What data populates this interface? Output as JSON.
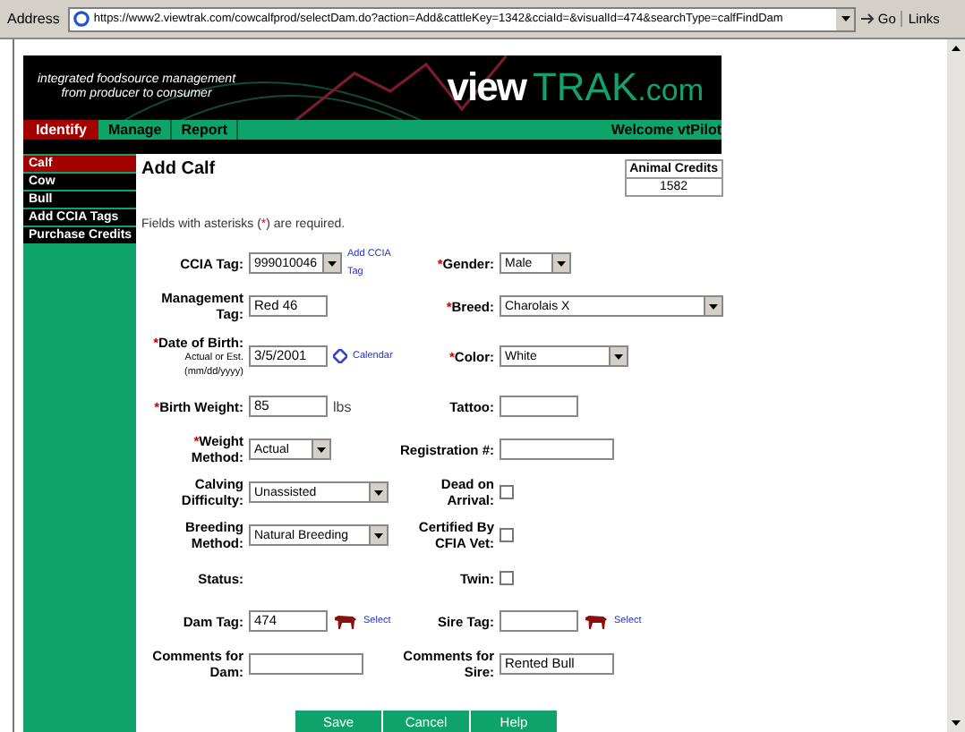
{
  "browser": {
    "address_label": "Address",
    "url": "https://www2.viewtrak.com/cowcalfprod/selectDam.do?action=Add&cattleKey=1342&cciaId=&visualId=474&searchType=calfFindDam",
    "go": "Go",
    "links": "Links"
  },
  "header": {
    "tagline_1": "integrated foodsource management",
    "tagline_2": "from producer to consumer",
    "logo_1": "view",
    "logo_2": "TRAK",
    "logo_3": ".com"
  },
  "nav": {
    "tabs": [
      {
        "label": "Identify",
        "selected": true
      },
      {
        "label": "Manage",
        "selected": false
      },
      {
        "label": "Report",
        "selected": false
      }
    ],
    "welcome": "Welcome vtPilot"
  },
  "sidebar": {
    "items": [
      {
        "label": "Calf",
        "selected": true
      },
      {
        "label": "Cow",
        "selected": false
      },
      {
        "label": "Bull",
        "selected": false
      },
      {
        "label": "Add CCIA Tags",
        "selected": false
      },
      {
        "label": "Purchase Credits",
        "selected": false
      }
    ]
  },
  "title": "Add Calf",
  "credits": {
    "label": "Animal Credits",
    "value": "1582"
  },
  "note": {
    "before": "Fields with asterisks (",
    "mark": "*",
    "after": ") are required."
  },
  "rows": [
    {
      "left": {
        "label": "CCIA Tag:",
        "required": false,
        "kind": "select",
        "value": "999010046",
        "link": "Add CCIA Tag"
      },
      "right": {
        "label": "Gender:",
        "required": true,
        "kind": "select",
        "value": "Male"
      }
    },
    {
      "left": {
        "label": "Management Tag:",
        "required": false,
        "kind": "text",
        "value": "Red 46"
      },
      "right": {
        "label": "Breed:",
        "required": true,
        "kind": "select",
        "value": "Charolais X"
      }
    },
    {
      "left": {
        "label": "Date of Birth:",
        "required": true,
        "kind": "text",
        "value": "3/5/2001",
        "hint_1": "Actual or Est.",
        "hint_2": "(mm/dd/yyyy)",
        "link": "Calendar"
      },
      "right": {
        "label": "Color:",
        "required": true,
        "kind": "select",
        "value": "White"
      }
    },
    {
      "left": {
        "label": "Birth Weight:",
        "required": true,
        "kind": "text",
        "value": "85",
        "unit": "lbs"
      },
      "right": {
        "label": "Tattoo:",
        "required": false,
        "kind": "text"
      }
    },
    {
      "left": {
        "label": "Weight Method:",
        "required": true,
        "kind": "select",
        "value": "Actual"
      },
      "right": {
        "label": "Registration #:",
        "required": false,
        "kind": "text"
      }
    },
    {
      "left": {
        "label": "Calving Difficulty:",
        "required": false,
        "kind": "select",
        "value": "Unassisted"
      },
      "right": {
        "label": "Dead on Arrival:",
        "required": false,
        "kind": "checkbox",
        "checked": false
      }
    },
    {
      "left": {
        "label": "Breeding Method:",
        "required": false,
        "kind": "select",
        "value": "Natural Breeding"
      },
      "right": {
        "label": "Certified By CFIA Vet:",
        "required": false,
        "kind": "checkbox",
        "checked": false
      }
    },
    {
      "left": {
        "label": "Status:",
        "required": false,
        "kind": "static"
      },
      "right": {
        "label": "Twin:",
        "required": false,
        "kind": "checkbox",
        "checked": false
      }
    },
    {
      "left": {
        "label": "Dam Tag:",
        "required": false,
        "kind": "tag",
        "value": "474",
        "link": "Select"
      },
      "right": {
        "label": "Sire Tag:",
        "required": false,
        "kind": "tag",
        "link": "Select"
      }
    },
    {
      "left": {
        "label": "Comments for Dam:",
        "required": false,
        "kind": "text"
      },
      "right": {
        "label": "Comments for Sire:",
        "required": false,
        "kind": "text",
        "value": "Rented Bull"
      }
    }
  ],
  "buttons": [
    "Save",
    "Cancel",
    "Help"
  ]
}
